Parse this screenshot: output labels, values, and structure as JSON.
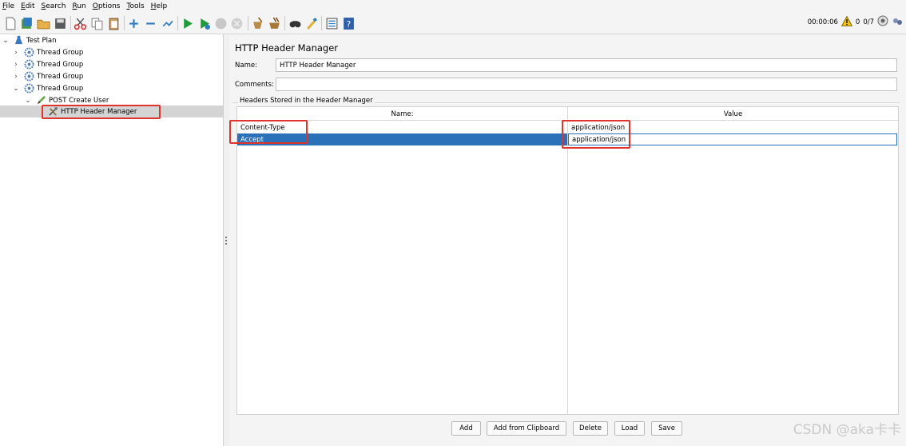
{
  "menu": [
    "File",
    "Edit",
    "Search",
    "Run",
    "Options",
    "Tools",
    "Help"
  ],
  "toolbar": {
    "icons": [
      "new-icon",
      "templates-icon",
      "open-icon",
      "save-icon",
      "cut-icon",
      "copy-icon",
      "paste-icon",
      "expand-icon",
      "collapse-icon",
      "toggle-icon",
      "start-icon",
      "start-no-pause-icon",
      "stop-icon",
      "shutdown-icon",
      "clear-icon",
      "clear-all-icon",
      "search-icon",
      "reset-search-icon",
      "function-helper-icon",
      "help-icon"
    ],
    "timer": "00:00:06",
    "warning_count": "0",
    "threads": "0/7"
  },
  "tree": {
    "items": [
      {
        "label": "Test Plan"
      },
      {
        "label": "Thread Group"
      },
      {
        "label": "Thread Group"
      },
      {
        "label": "Thread Group"
      },
      {
        "label": "Thread Group"
      },
      {
        "label": "POST Create User"
      },
      {
        "label": "HTTP Header Manager"
      }
    ]
  },
  "panel": {
    "title": "HTTP Header Manager",
    "name_label": "Name:",
    "name_value": "HTTP Header Manager",
    "comments_label": "Comments:",
    "comments_value": "",
    "group_label": "Headers Stored in the Header Manager",
    "table": {
      "headers": [
        "Name:",
        "Value"
      ],
      "rows": [
        {
          "name": "Content-Type",
          "value": "application/json"
        },
        {
          "name": "Accept",
          "value": "application/json"
        }
      ]
    },
    "buttons": {
      "add": "Add",
      "add_clipboard": "Add from Clipboard",
      "delete": "Delete",
      "load": "Load",
      "save": "Save"
    }
  },
  "watermark": "CSDN @aka卡卡",
  "colors": {
    "selection": "#2a71b9",
    "highlight_box": "#e0342c"
  }
}
